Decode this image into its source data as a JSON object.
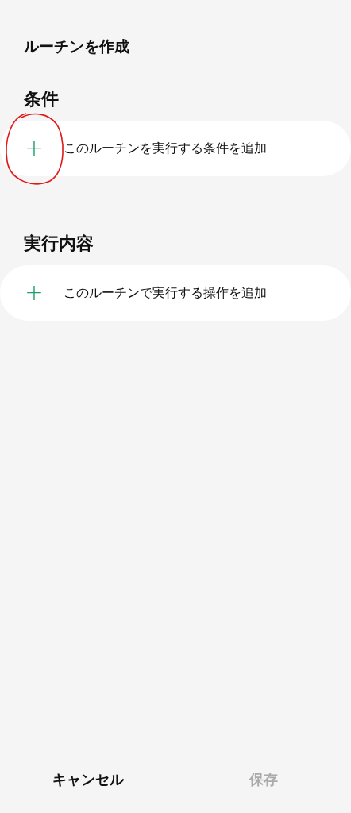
{
  "title": "ルーチンを作成",
  "sections": [
    {
      "heading": "条件",
      "add_row": {
        "icon": "+",
        "label": "このルーチンを実行する条件を追加",
        "circled": true
      }
    },
    {
      "heading": "実行内容",
      "add_row": {
        "icon": "+",
        "label": "このルーチンで実行する操作を追加",
        "circled": false
      }
    }
  ],
  "buttons": [
    {
      "label": "キャンセル",
      "disabled": false
    },
    {
      "label": "保存",
      "disabled": true
    }
  ]
}
